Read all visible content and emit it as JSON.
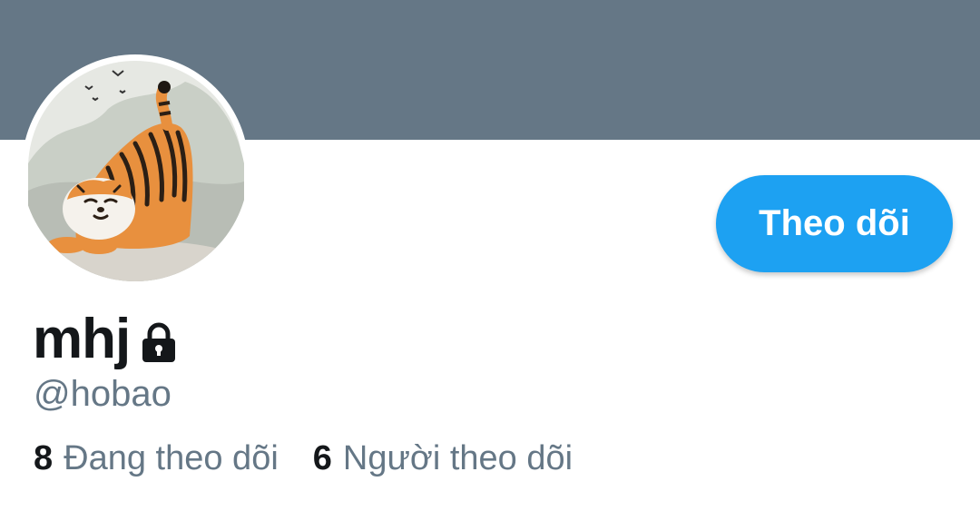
{
  "profile": {
    "display_name": "mhj",
    "handle": "@hobao",
    "protected_icon": "lock-icon",
    "avatar_icon": "tiger-avatar"
  },
  "actions": {
    "follow_label": "Theo dõi"
  },
  "stats": {
    "following_count": "8",
    "following_label": "Đang theo dõi",
    "followers_count": "6",
    "followers_label": "Người theo dõi"
  },
  "colors": {
    "banner": "#657786",
    "accent": "#1da1f2",
    "text_primary": "#14171a",
    "text_secondary": "#657786"
  }
}
